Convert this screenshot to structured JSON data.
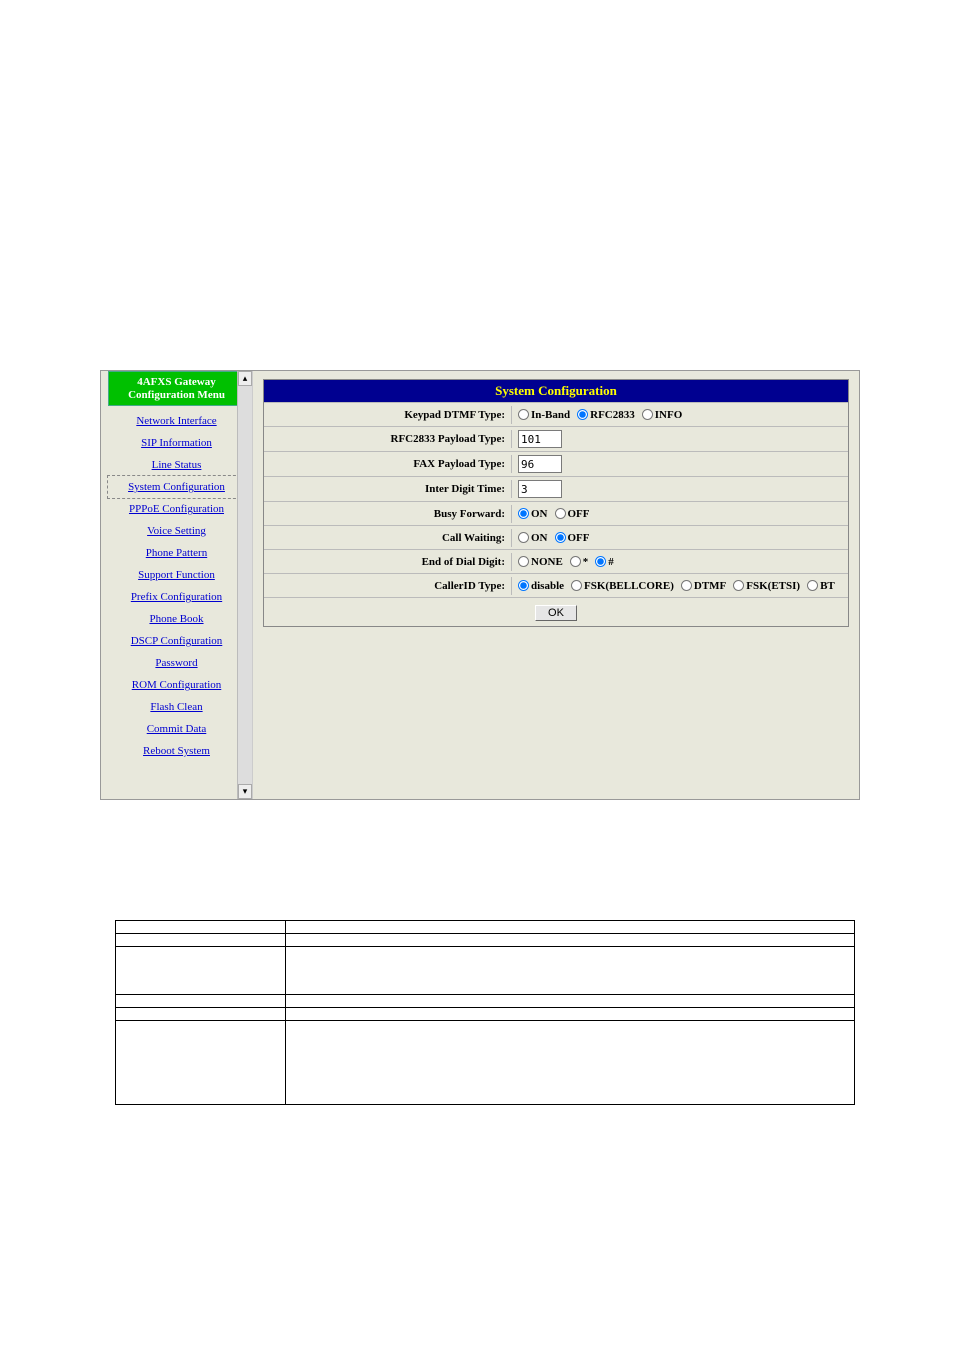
{
  "sidebar": {
    "header_line1": "4AFXS Gateway",
    "header_line2": "Configuration Menu",
    "items": [
      {
        "label": "Network Interface"
      },
      {
        "label": "SIP Information"
      },
      {
        "label": "Line Status"
      },
      {
        "label": "System Configuration",
        "current": true
      },
      {
        "label": "PPPoE Configuration"
      },
      {
        "label": "Voice Setting"
      },
      {
        "label": "Phone Pattern"
      },
      {
        "label": "Support Function"
      },
      {
        "label": "Prefix Configuration"
      },
      {
        "label": "Phone Book"
      },
      {
        "label": "DSCP Configuration"
      },
      {
        "label": "Password"
      },
      {
        "label": "ROM Configuration"
      },
      {
        "label": "Flash Clean"
      },
      {
        "label": "Commit Data"
      },
      {
        "label": "Reboot System"
      }
    ]
  },
  "panel": {
    "title": "System Configuration",
    "ok_label": "OK",
    "rows": {
      "keypad": {
        "label": "Keypad DTMF Type:",
        "opts": [
          "In-Band",
          "RFC2833",
          "INFO"
        ],
        "selected": "RFC2833"
      },
      "rfc2833": {
        "label": "RFC2833 Payload Type:",
        "value": "101"
      },
      "fax": {
        "label": "FAX Payload Type:",
        "value": "96"
      },
      "inter": {
        "label": "Inter Digit Time:",
        "value": "3"
      },
      "busy": {
        "label": "Busy Forward:",
        "opts": [
          "ON",
          "OFF"
        ],
        "selected": "ON"
      },
      "cw": {
        "label": "Call Waiting:",
        "opts": [
          "ON",
          "OFF"
        ],
        "selected": "OFF"
      },
      "eod": {
        "label": "End of Dial Digit:",
        "opts": [
          "NONE",
          "*",
          "#"
        ],
        "selected": "#"
      },
      "cid": {
        "label": "CallerID Type:",
        "opts": [
          "disable",
          "FSK(BELLCORE)",
          "DTMF",
          "FSK(ETSI)",
          "BT"
        ],
        "selected": "disable"
      }
    }
  },
  "scroll": {
    "up": "▴",
    "down": "▾"
  },
  "doc_rows": [
    {
      "c1": "",
      "c2": ""
    },
    {
      "c1": "",
      "c2": ""
    },
    {
      "c1": "",
      "c2": ""
    },
    {
      "c1": "",
      "c2": ""
    },
    {
      "c1": "",
      "c2": ""
    },
    {
      "c1": "",
      "c2": ""
    }
  ]
}
